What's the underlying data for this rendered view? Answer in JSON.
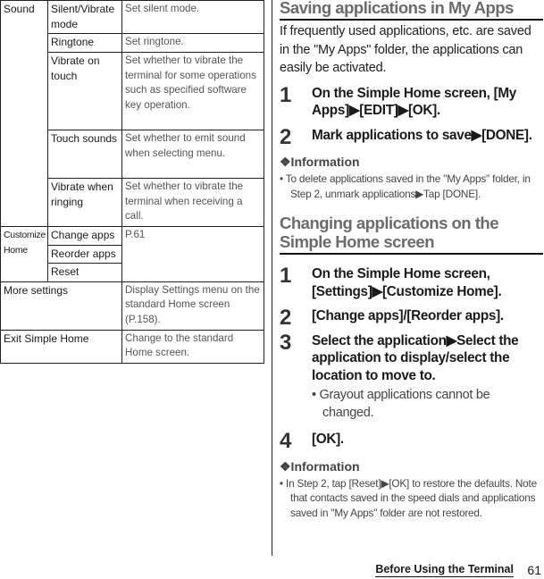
{
  "settings_table": {
    "sound": {
      "label": "Sound",
      "rows": [
        {
          "name": "Silent/Vibrate mode",
          "desc": "Set silent mode."
        },
        {
          "name": "Ringtone",
          "desc": "Set ringtone."
        },
        {
          "name": "Vibrate on touch",
          "desc": "Set whether to vibrate the terminal for some operations such as specified software key operation."
        },
        {
          "name": "Touch sounds",
          "desc": "Set whether to emit sound when selecting menu."
        },
        {
          "name": "Vibrate when ringing",
          "desc": "Set whether to vibrate the terminal when receiving a call."
        }
      ]
    },
    "customize_home": {
      "label": "Customize Home",
      "rows": [
        {
          "name": "Change apps"
        },
        {
          "name": "Reorder apps"
        },
        {
          "name": "Reset"
        }
      ],
      "desc": "P.61"
    },
    "more_settings": {
      "name": "More settings",
      "desc": "Display Settings menu on the standard Home screen (P.158)."
    },
    "exit_simple_home": {
      "name": "Exit Simple Home",
      "desc": "Change to the standard Home screen."
    }
  },
  "section1": {
    "title": "Saving applications in My Apps",
    "intro": "If frequently used applications, etc. are saved in the \"My Apps\" folder, the applications can easily be activated.",
    "steps": [
      {
        "num": "1",
        "text": "On the Simple Home screen, [My Apps]▶[EDIT]▶[OK]."
      },
      {
        "num": "2",
        "text": "Mark applications to save▶[DONE]."
      }
    ],
    "info_title": "❖Information",
    "info_items": [
      "To delete applications saved in the \"My Apps\" folder, in Step 2, unmark applications▶Tap [DONE]."
    ]
  },
  "section2": {
    "title": "Changing applications on the Simple Home screen",
    "steps": [
      {
        "num": "1",
        "text": "On the Simple Home screen, [Settings]▶[Customize Home]."
      },
      {
        "num": "2",
        "text": "[Change apps]/[Reorder apps]."
      },
      {
        "num": "3",
        "text": "Select the application▶Select the application to display/select the location to move to.",
        "sub": "Grayout applications cannot be changed."
      },
      {
        "num": "4",
        "text": "[OK]."
      }
    ],
    "info_title": "❖Information",
    "info_items": [
      "In Step 2, tap [Reset]▶[OK] to restore the defaults. Note that contacts saved in the speed dials and applications saved in \"My Apps\" folder are not restored."
    ]
  },
  "footer": {
    "chapter": "Before Using the Terminal",
    "page": "61"
  }
}
